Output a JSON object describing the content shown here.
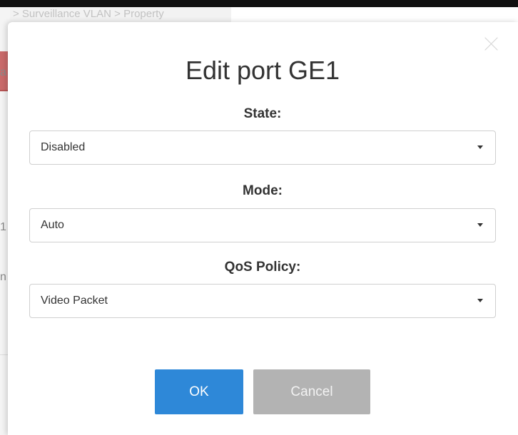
{
  "background": {
    "breadcrumb": "> Surveillance VLAN > Property",
    "left_fragments": [
      "a",
      "1",
      "n"
    ]
  },
  "dialog": {
    "title": "Edit port GE1",
    "close_icon": "close-icon",
    "fields": [
      {
        "label": "State:",
        "value": "Disabled"
      },
      {
        "label": "Mode:",
        "value": "Auto"
      },
      {
        "label": "QoS Policy:",
        "value": "Video Packet"
      }
    ],
    "ok_label": "OK",
    "cancel_label": "Cancel"
  },
  "colors": {
    "ok_button": "#2e88d8",
    "cancel_button": "#b3b3b3"
  }
}
